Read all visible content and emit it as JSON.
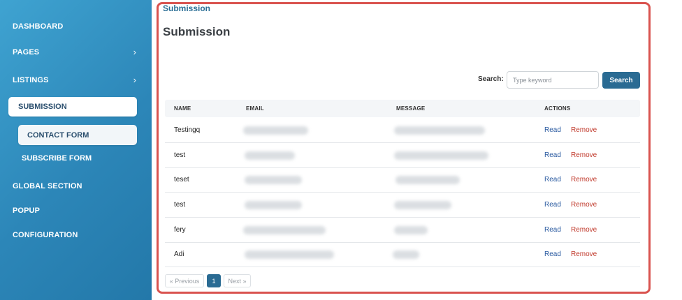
{
  "sidebar": {
    "items": [
      {
        "label": "DASHBOARD"
      },
      {
        "label": "PAGES",
        "chevron": "›"
      },
      {
        "label": "LISTINGS",
        "chevron": "›"
      },
      {
        "label": "SUBMISSION"
      },
      {
        "label": "CONTACT FORM"
      },
      {
        "label": "SUBSCRIBE FORM"
      },
      {
        "label": "GLOBAL SECTION"
      },
      {
        "label": "POPUP"
      },
      {
        "label": "CONFIGURATION"
      }
    ]
  },
  "header": {
    "breadcrumb": "Submission",
    "title": "Submission"
  },
  "search": {
    "label": "Search:",
    "placeholder": "Type keyword",
    "button": "Search"
  },
  "table": {
    "columns": [
      "NAME",
      "EMAIL",
      "MESSAGE",
      "ACTIONS"
    ],
    "rows": [
      {
        "name": "Testingq",
        "read": "Read",
        "remove": "Remove"
      },
      {
        "name": "test",
        "read": "Read",
        "remove": "Remove"
      },
      {
        "name": "teset",
        "read": "Read",
        "remove": "Remove"
      },
      {
        "name": "test",
        "read": "Read",
        "remove": "Remove"
      },
      {
        "name": "fery",
        "read": "Read",
        "remove": "Remove"
      },
      {
        "name": "Adi",
        "read": "Read",
        "remove": "Remove"
      }
    ]
  },
  "pagination": {
    "prev": "« Previous",
    "page": "1",
    "next": "Next »"
  },
  "colors": {
    "accent": "#2a6b93",
    "panel_border": "#d9534f",
    "remove": "#c0392b",
    "read": "#2a5aa0"
  }
}
